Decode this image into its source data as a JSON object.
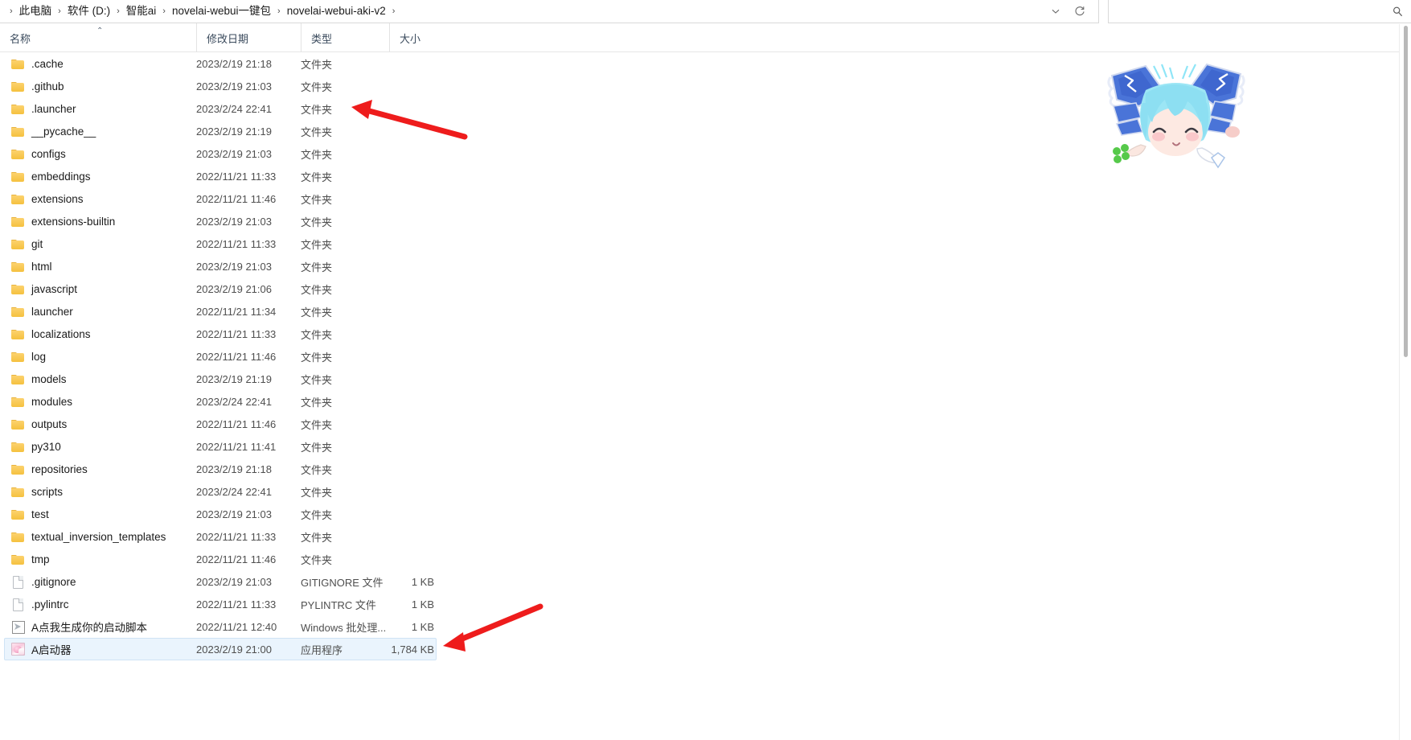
{
  "window": {
    "app": "windows-file-explorer"
  },
  "address_bar": {
    "breadcrumbs": [
      {
        "label": "此电脑"
      },
      {
        "label": "软件 (D:)"
      },
      {
        "label": "智能ai"
      },
      {
        "label": "novelai-webui一键包"
      },
      {
        "label": "novelai-webui-aki-v2"
      }
    ],
    "separator": "›",
    "history_dropdown_icon": "chevron-down-icon",
    "refresh_icon": "refresh-icon"
  },
  "search": {
    "value": "",
    "placeholder": "",
    "icon": "search-icon"
  },
  "columns": {
    "name": "名称",
    "date_modified": "修改日期",
    "type": "类型",
    "size": "大小",
    "sort_caret": "⌃",
    "sort_column": "名称",
    "sort_direction": "ascending"
  },
  "files": [
    {
      "name": ".cache",
      "date": "2023/2/19 21:18",
      "type": "文件夹",
      "size": "",
      "icon": "folder-icon",
      "selected": false
    },
    {
      "name": ".github",
      "date": "2023/2/19 21:03",
      "type": "文件夹",
      "size": "",
      "icon": "folder-icon",
      "selected": false
    },
    {
      "name": ".launcher",
      "date": "2023/2/24 22:41",
      "type": "文件夹",
      "size": "",
      "icon": "folder-icon",
      "selected": false
    },
    {
      "name": "__pycache__",
      "date": "2023/2/19 21:19",
      "type": "文件夹",
      "size": "",
      "icon": "folder-icon",
      "selected": false
    },
    {
      "name": "configs",
      "date": "2023/2/19 21:03",
      "type": "文件夹",
      "size": "",
      "icon": "folder-icon",
      "selected": false
    },
    {
      "name": "embeddings",
      "date": "2022/11/21 11:33",
      "type": "文件夹",
      "size": "",
      "icon": "folder-icon",
      "selected": false
    },
    {
      "name": "extensions",
      "date": "2022/11/21 11:46",
      "type": "文件夹",
      "size": "",
      "icon": "folder-icon",
      "selected": false
    },
    {
      "name": "extensions-builtin",
      "date": "2023/2/19 21:03",
      "type": "文件夹",
      "size": "",
      "icon": "folder-icon",
      "selected": false
    },
    {
      "name": "git",
      "date": "2022/11/21 11:33",
      "type": "文件夹",
      "size": "",
      "icon": "folder-icon",
      "selected": false
    },
    {
      "name": "html",
      "date": "2023/2/19 21:03",
      "type": "文件夹",
      "size": "",
      "icon": "folder-icon",
      "selected": false
    },
    {
      "name": "javascript",
      "date": "2023/2/19 21:06",
      "type": "文件夹",
      "size": "",
      "icon": "folder-icon",
      "selected": false
    },
    {
      "name": "launcher",
      "date": "2022/11/21 11:34",
      "type": "文件夹",
      "size": "",
      "icon": "folder-icon",
      "selected": false
    },
    {
      "name": "localizations",
      "date": "2022/11/21 11:33",
      "type": "文件夹",
      "size": "",
      "icon": "folder-icon",
      "selected": false
    },
    {
      "name": "log",
      "date": "2022/11/21 11:46",
      "type": "文件夹",
      "size": "",
      "icon": "folder-icon",
      "selected": false
    },
    {
      "name": "models",
      "date": "2023/2/19 21:19",
      "type": "文件夹",
      "size": "",
      "icon": "folder-icon",
      "selected": false
    },
    {
      "name": "modules",
      "date": "2023/2/24 22:41",
      "type": "文件夹",
      "size": "",
      "icon": "folder-icon",
      "selected": false
    },
    {
      "name": "outputs",
      "date": "2022/11/21 11:46",
      "type": "文件夹",
      "size": "",
      "icon": "folder-icon",
      "selected": false
    },
    {
      "name": "py310",
      "date": "2022/11/21 11:41",
      "type": "文件夹",
      "size": "",
      "icon": "folder-icon",
      "selected": false
    },
    {
      "name": "repositories",
      "date": "2023/2/19 21:18",
      "type": "文件夹",
      "size": "",
      "icon": "folder-icon",
      "selected": false
    },
    {
      "name": "scripts",
      "date": "2023/2/24 22:41",
      "type": "文件夹",
      "size": "",
      "icon": "folder-icon",
      "selected": false
    },
    {
      "name": "test",
      "date": "2023/2/19 21:03",
      "type": "文件夹",
      "size": "",
      "icon": "folder-icon",
      "selected": false
    },
    {
      "name": "textual_inversion_templates",
      "date": "2022/11/21 11:33",
      "type": "文件夹",
      "size": "",
      "icon": "folder-icon",
      "selected": false
    },
    {
      "name": "tmp",
      "date": "2022/11/21 11:46",
      "type": "文件夹",
      "size": "",
      "icon": "folder-icon",
      "selected": false
    },
    {
      "name": ".gitignore",
      "date": "2023/2/19 21:03",
      "type": "GITIGNORE 文件",
      "size": "1 KB",
      "icon": "file-icon",
      "selected": false
    },
    {
      "name": ".pylintrc",
      "date": "2022/11/21 11:33",
      "type": "PYLINTRC 文件",
      "size": "1 KB",
      "icon": "file-icon",
      "selected": false
    },
    {
      "name": "A点我生成你的启动脚本",
      "date": "2022/11/21 12:40",
      "type": "Windows 批处理...",
      "size": "1 KB",
      "icon": "bat-file-icon",
      "selected": false
    },
    {
      "name": "A启动器",
      "date": "2023/2/19 21:00",
      "type": "应用程序",
      "size": "1,784 KB",
      "icon": "app-icon",
      "selected": true
    }
  ],
  "annotations": {
    "arrow_color": "#ee1c1c",
    "arrows": [
      {
        "name": "arrow-pointing-to-launcher-folder",
        "target": ".launcher"
      },
      {
        "name": "arrow-pointing-to-selected-launcher-app",
        "target": "A启动器"
      }
    ]
  },
  "mascot": {
    "name": "anime-character-decoration",
    "description": "chibi anime girl with light blue hair in blue dress lying down"
  },
  "scrollbar": {
    "orientation": "vertical",
    "position": "top"
  },
  "colors": {
    "selection_bg": "#eaf4fd",
    "selection_border": "#cfe3f5",
    "folder": "#f5c13f",
    "header_text": "#3a4a5c",
    "annotation_red": "#ee1c1c"
  }
}
